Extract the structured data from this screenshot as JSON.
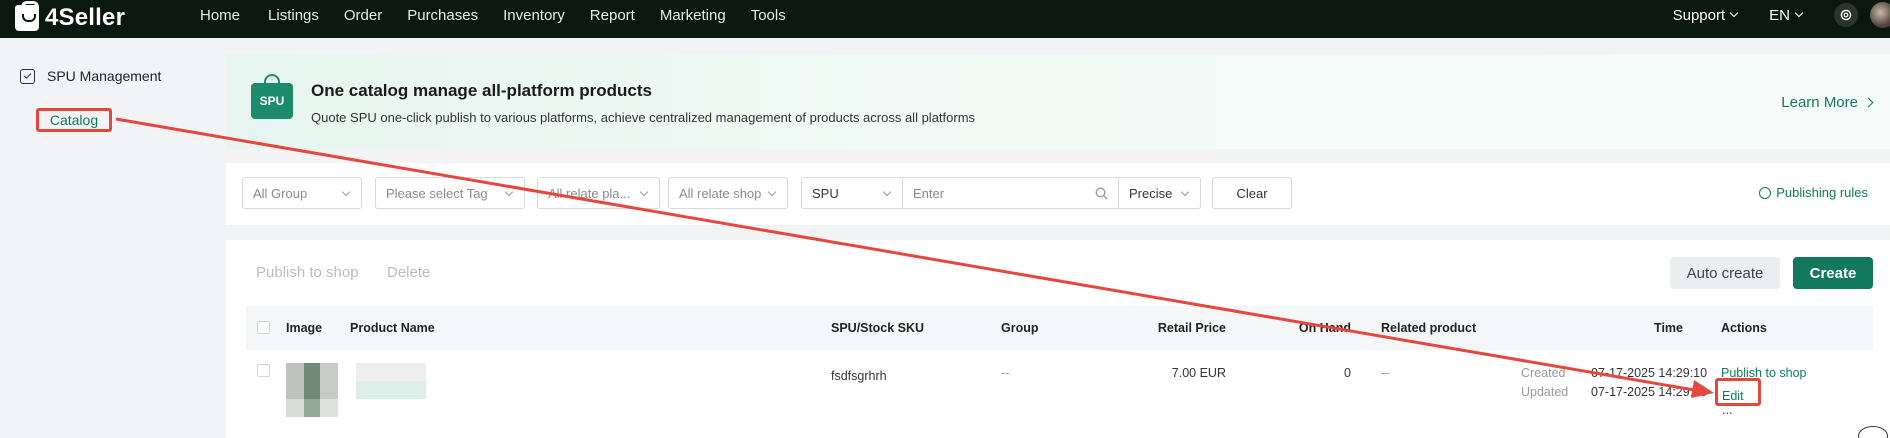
{
  "app": {
    "logo_text": "4Seller",
    "nav": [
      "Home",
      "Listings",
      "Order",
      "Purchases",
      "Inventory",
      "Report",
      "Marketing",
      "Tools"
    ],
    "support_label": "Support",
    "language_label": "EN"
  },
  "sidebar": {
    "section_label": "SPU Management",
    "items": [
      {
        "label": "Catalog",
        "active": true
      }
    ]
  },
  "banner": {
    "badge": "SPU",
    "title": "One catalog manage all-platform products",
    "subtitle": "Quote SPU one-click publish to various platforms, achieve centralized management of products across all platforms",
    "learn_more": "Learn More"
  },
  "filters": {
    "group": "All Group",
    "tag_placeholder": "Please select Tag",
    "platform_placeholder": "All relate pla...",
    "shop_placeholder": "All relate shop",
    "search_type": "SPU",
    "search_placeholder": "Enter",
    "match_mode": "Precise",
    "clear": "Clear",
    "publishing_rules": "Publishing rules"
  },
  "toolbar": {
    "publish": "Publish to shop",
    "delete": "Delete",
    "auto_create": "Auto create",
    "create": "Create"
  },
  "table": {
    "columns": [
      "Image",
      "Product Name",
      "SPU/Stock SKU",
      "Group",
      "Retail Price",
      "On Hand",
      "Related product",
      "Time",
      "Actions"
    ],
    "rows": [
      {
        "spu": "fsdfsgrhrh",
        "group": "--",
        "retail_price": "7.00 EUR",
        "on_hand": "0",
        "related": "--",
        "created_label": "Created",
        "created": "07-17-2025 14:29:10",
        "updated_label": "Updated",
        "updated": "07-17-2025 14:29:10",
        "actions": [
          "Publish to shop",
          "Edit",
          "..."
        ]
      }
    ]
  },
  "colors": {
    "brand": "#12795a",
    "annotation": "#e5473d",
    "topbar": "#0b1711"
  }
}
